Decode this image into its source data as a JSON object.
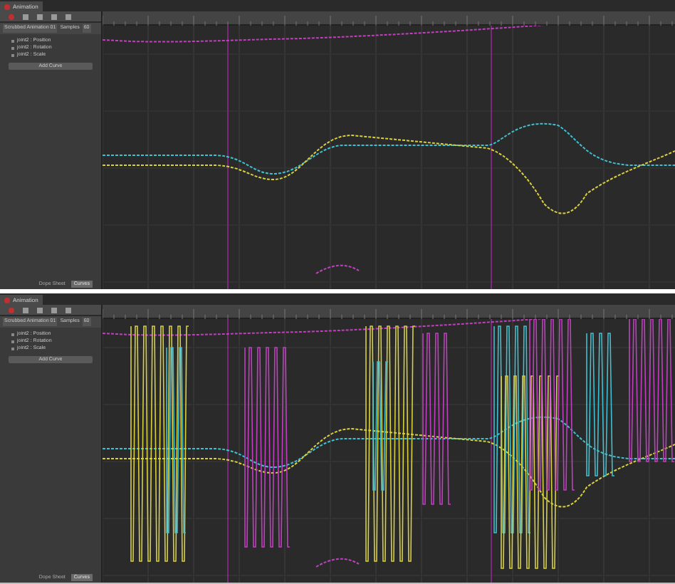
{
  "panels": [
    {
      "tab": "Animation",
      "clip": "Scrubbed Animation 01",
      "samples_label": "Samples",
      "samples": "60",
      "tracks": [
        {
          "label": "joint2 : Position"
        },
        {
          "label": "joint2 : Rotation"
        },
        {
          "label": "joint2 : Scale"
        }
      ],
      "add_curve": "Add Curve",
      "kind": "smooth",
      "view_tabs": [
        {
          "label": "Dope Sheet",
          "selected": false
        },
        {
          "label": "Curves",
          "selected": true
        }
      ]
    },
    {
      "tab": "Animation",
      "clip": "Scrubbed Animation 01",
      "samples_label": "Samples",
      "samples": "60",
      "tracks": [
        {
          "label": "joint2 : Position"
        },
        {
          "label": "joint2 : Rotation"
        },
        {
          "label": "joint2 : Scale"
        }
      ],
      "add_curve": "Add Curve",
      "kind": "jittery",
      "view_tabs": [
        {
          "label": "Dope Sheet",
          "selected": false
        },
        {
          "label": "Curves",
          "selected": true
        }
      ]
    }
  ]
}
